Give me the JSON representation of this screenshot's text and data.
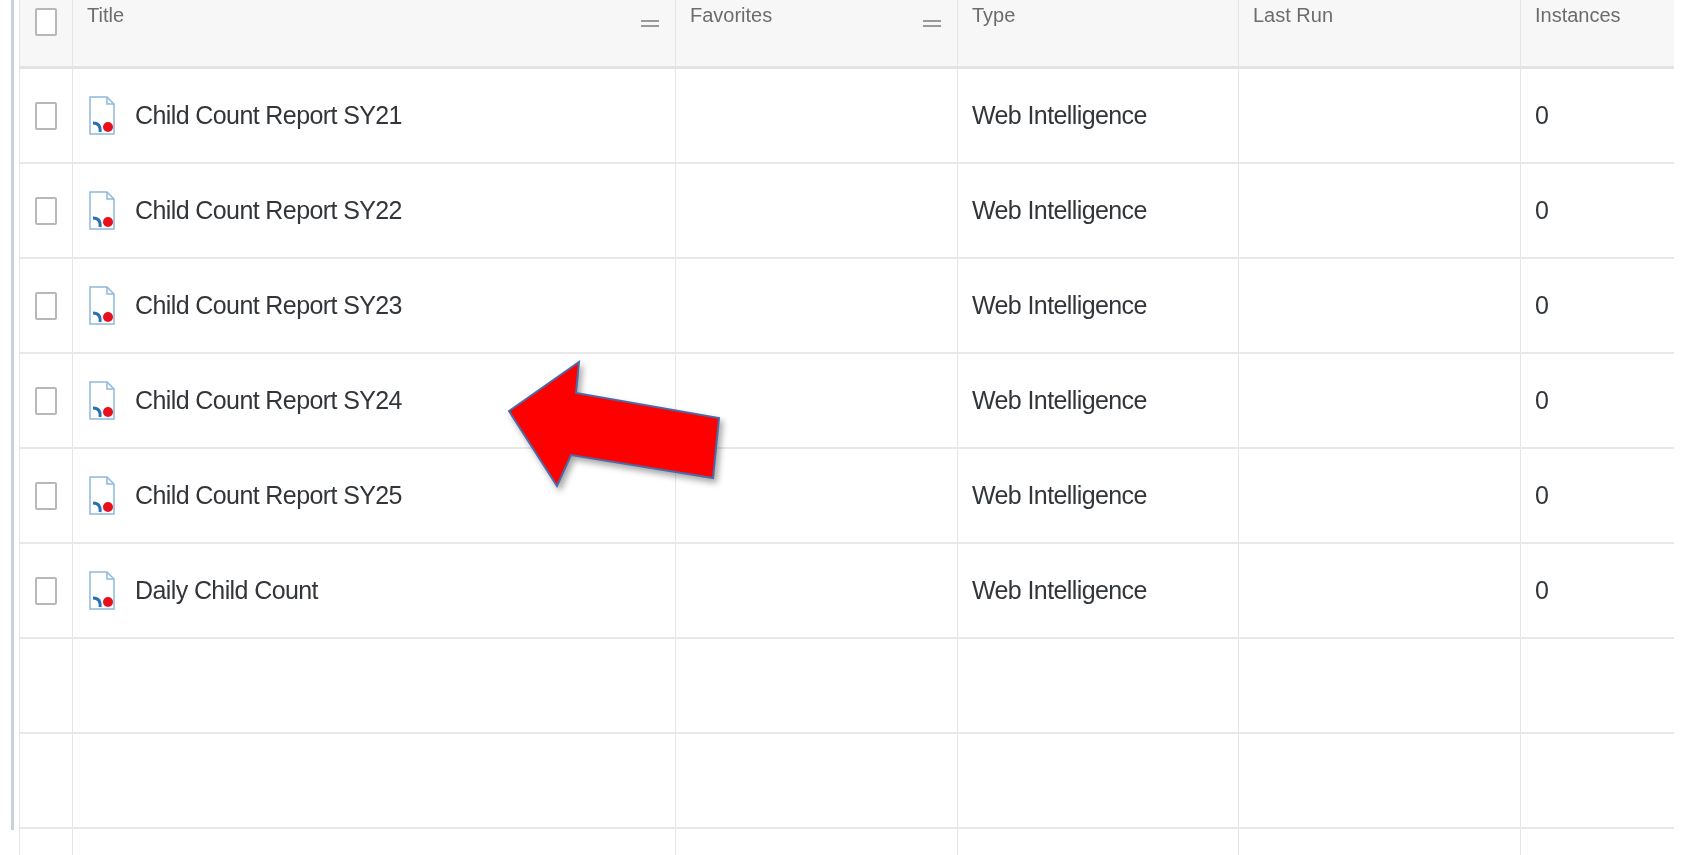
{
  "table": {
    "columns": [
      {
        "label": "Title",
        "menu": true
      },
      {
        "label": "Favorites",
        "menu": true
      },
      {
        "label": "Type",
        "menu": false
      },
      {
        "label": "Last Run",
        "menu": false
      },
      {
        "label": "Instances",
        "menu": false
      }
    ],
    "header_checked": false,
    "rows": [
      {
        "checked": false,
        "title": "Child Count Report SY21",
        "type": "Web Intelligence",
        "instances": "0"
      },
      {
        "checked": false,
        "title": "Child Count Report SY22",
        "type": "Web Intelligence",
        "instances": "0"
      },
      {
        "checked": false,
        "title": "Child Count Report SY23",
        "type": "Web Intelligence",
        "instances": "0"
      },
      {
        "checked": false,
        "title": "Child Count Report SY24",
        "type": "Web Intelligence",
        "instances": "0"
      },
      {
        "checked": false,
        "title": "Child Count Report SY25",
        "type": "Web Intelligence",
        "instances": "0"
      },
      {
        "checked": false,
        "title": "Daily Child Count",
        "type": "Web Intelligence",
        "instances": "0"
      }
    ]
  }
}
